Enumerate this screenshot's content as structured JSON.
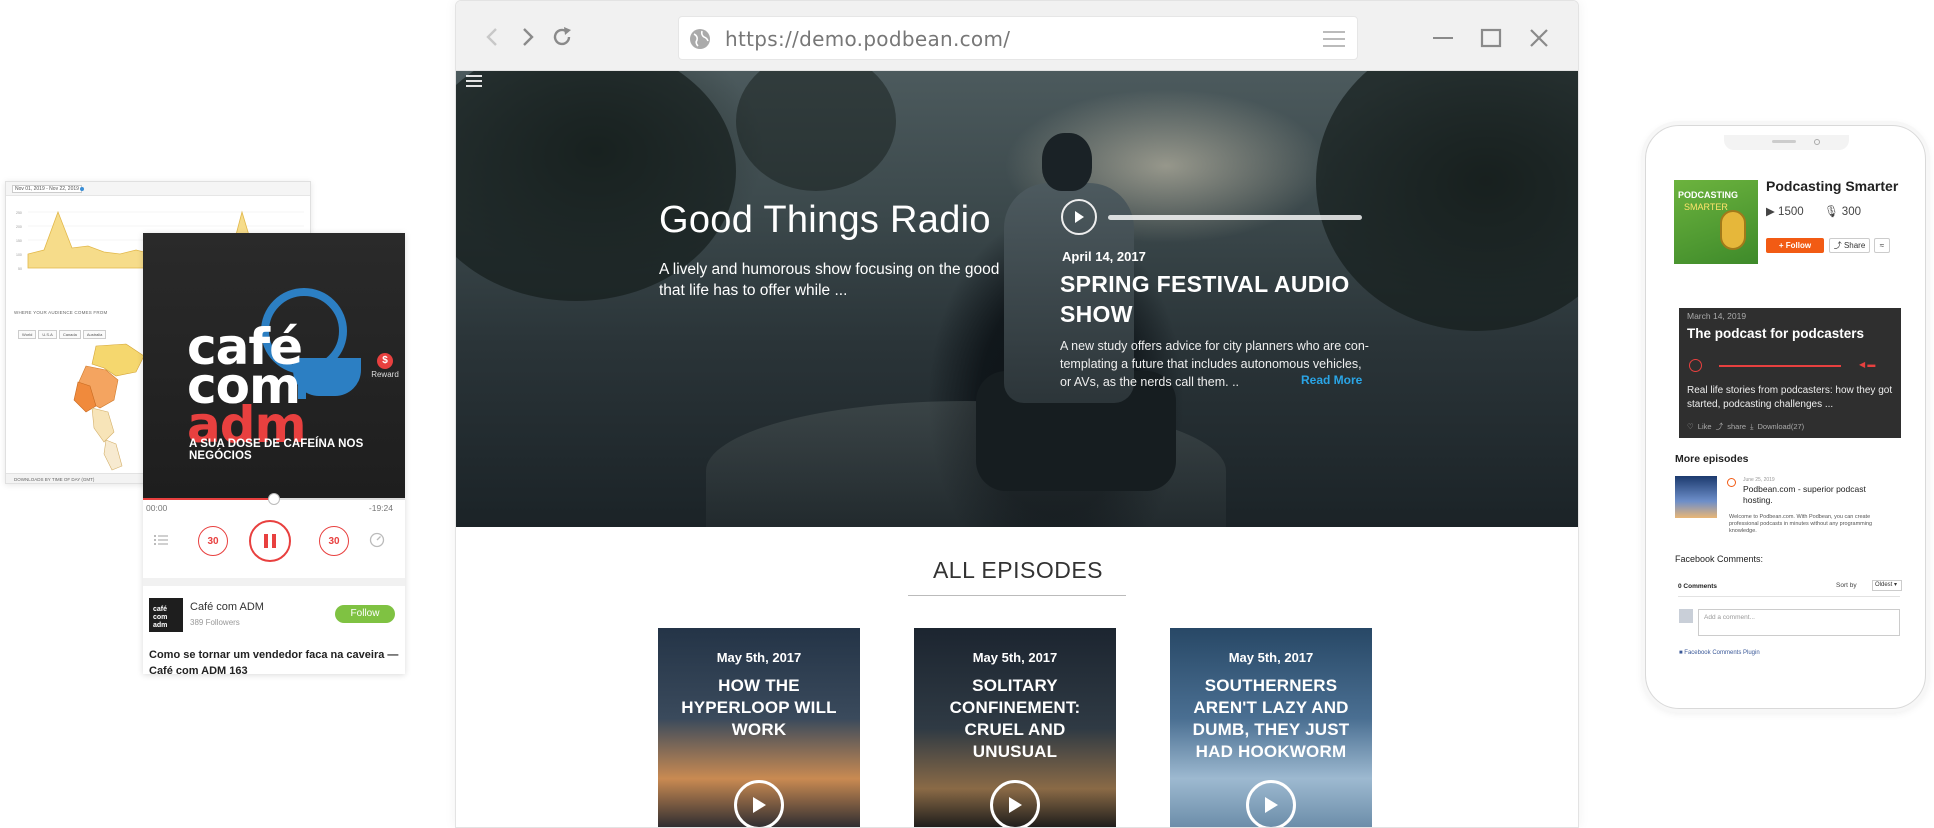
{
  "browser": {
    "url": "https://demo.podbean.com/"
  },
  "hero": {
    "show_title": "Good Things Radio",
    "show_description": "A lively and humorous show focusing on the good that life has to offer while ...",
    "episode_date": "April 14, 2017",
    "episode_title": "SPRING FESTIVAL AUDIO SHOW",
    "episode_description": "A new study offers advice for city planners who are con-templating a future that includes autonomous vehicles, or AVs, as the nerds call them. ..",
    "read_more": "Read More"
  },
  "episodes_section": {
    "heading": "ALL EPISODES",
    "cards": [
      {
        "date": "May 5th, 2017",
        "title": "HOW THE HYPERLOOP WILL WORK"
      },
      {
        "date": "May 5th, 2017",
        "title": "SOLITARY CONFINEMENT: CRUEL AND UNUSUAL"
      },
      {
        "date": "May 5th, 2017",
        "title": "SOUTHERNERS AREN'T LAZY AND DUMB, THEY JUST HAD HOOKWORM"
      }
    ]
  },
  "analytics": {
    "date_range": "Nov 01, 2019 - Nov 22, 2019",
    "map_heading": "WHERE YOUR AUDIENCE COMES FROM",
    "map_tabs": [
      "World",
      "U.S.A",
      "Canada",
      "Australia"
    ],
    "footer_heading": "DOWNLOADS BY TIME OF DAY (GMT)"
  },
  "player": {
    "cover_line1": "café",
    "cover_line2": "com",
    "cover_line3": "adm",
    "cover_tagline": "A SUA DOSE DE CAFEÍNA NOS NEGÓCIOS",
    "reward_label": "Reward",
    "reward_symbol": "$",
    "time_elapsed": "00:00",
    "time_remaining": "-19:24",
    "skip_back": "30",
    "skip_forward": "30",
    "podcast_name": "Café com ADM",
    "followers": "389 Followers",
    "follow_label": "Follow",
    "thumb_text": "café com adm",
    "episode_title": "Como se tornar um vendedor faca na caveira — Café com ADM 163",
    "progress": 0.5
  },
  "phone": {
    "art_line1": "PODCASTING",
    "art_line2": "SMARTER",
    "podcast_name": "Podcasting Smarter",
    "plays": "1500",
    "likes": "300",
    "follow_label": "Follow",
    "share_label": "Share",
    "episode_card": {
      "date": "March 14, 2019",
      "title": "The podcast for podcasters",
      "description": "Real life stories from podcasters: how they got started, podcasting challenges ...",
      "actions": "♡ Like   ⤴ share   ⤓ Download(27)"
    },
    "more_episodes": "More episodes",
    "more_episode": {
      "date": "June 25, 2019",
      "title": "Podbean.com - superior podcast hosting.",
      "description": "Welcome to Podbean.com. With Podbean, you can create professional podcasts in minutes without any programming knowledge."
    },
    "fb_heading": "Facebook Comments:",
    "comment_count": "0 Comments",
    "sort_label": "Sort by",
    "sort_value": "Oldest",
    "comment_placeholder": "Add a comment...",
    "plugin_label": "Facebook Comments Plugin"
  },
  "colors": {
    "accent_red": "#e8403f",
    "follow_green": "#7fc242",
    "podbean_orange": "#f25b14",
    "link_blue": "#2aa5e6"
  }
}
